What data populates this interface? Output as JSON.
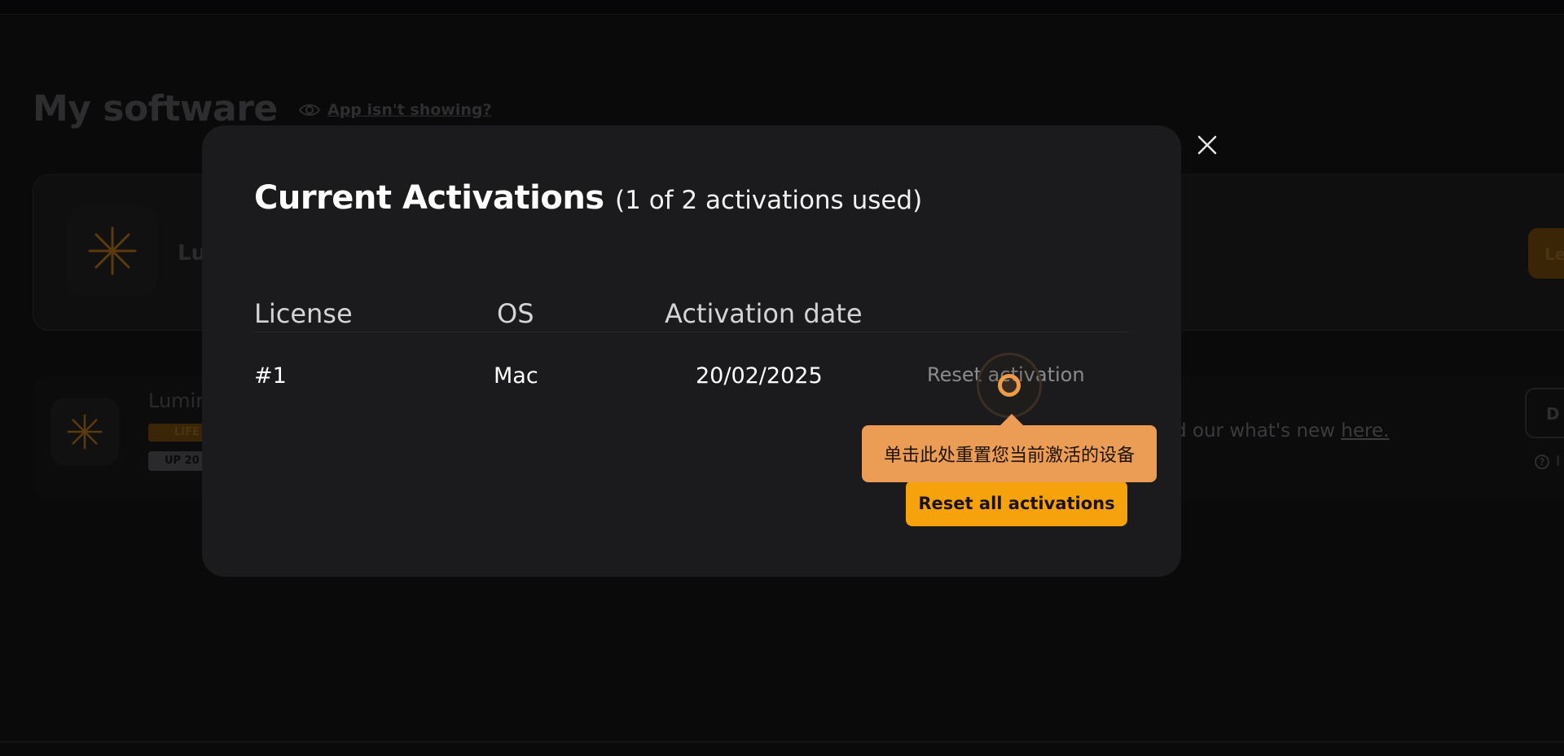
{
  "background": {
    "page_title": "My software",
    "app_missing_link": "App isn't showing?",
    "card1_name": "Lu",
    "card2_name": "Lumin",
    "card2_badge1": "LIFE",
    "card2_badge2": "UP 20",
    "news_text": "d our what's new ",
    "news_link": "here.",
    "learn_button": "Le",
    "download_button": "D",
    "help_link": "I"
  },
  "modal": {
    "title": "Current Activations",
    "subtitle": "(1 of 2 activations used)",
    "columns": [
      "License",
      "OS",
      "Activation date"
    ],
    "rows": [
      {
        "license": "#1",
        "os": "Mac",
        "date": "20/02/2025",
        "action": "Reset activation"
      }
    ],
    "reset_all_label": "Reset all activations"
  },
  "tooltip": {
    "text": "单击此处重置您当前激活的设备"
  },
  "colors": {
    "accent": "#f5a20d",
    "tooltip_bg": "#eb9d55",
    "modal_bg": "#1b1b1d"
  }
}
